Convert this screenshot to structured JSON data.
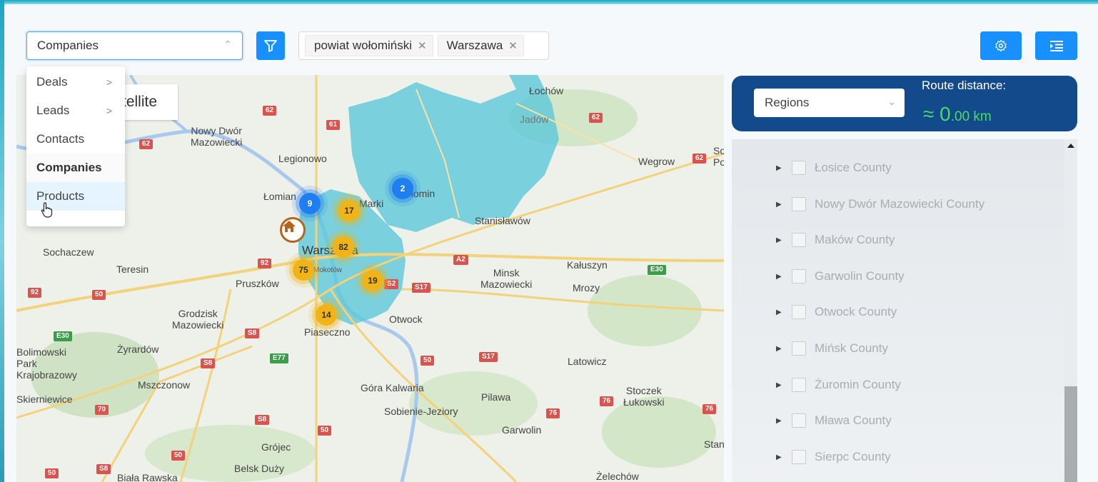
{
  "toolbar": {
    "entity_select_value": "Companies",
    "filter_tags": [
      "powiat wołomiński",
      "Warszawa"
    ]
  },
  "dropdown": {
    "items": [
      {
        "label": "Deals",
        "has_submenu": true
      },
      {
        "label": "Leads",
        "has_submenu": true
      },
      {
        "label": "Contacts",
        "has_submenu": false
      },
      {
        "label": "Companies",
        "has_submenu": false,
        "selected": true
      },
      {
        "label": "Products",
        "has_submenu": false,
        "hovered": true
      }
    ]
  },
  "map": {
    "satellite_label": "tellite",
    "places": [
      "Łochów",
      "Jadów",
      "Nowy Dwór\nMazowiecki",
      "Legionowo",
      "Wegrow",
      "Łomian",
      "Stanisławów",
      "Sochaczew",
      "Teresin",
      "Pruszków",
      "Minsk\nMazowiecki",
      "Kałuszyn",
      "Mrozy",
      "Grodzisk\nMazowiecki",
      "Otwock",
      "Piaseczno",
      "Żyrardów",
      "Bolimowski\nPark\nKrajobrazowy",
      "Mszczonow",
      "Skierniewice",
      "Latowicz",
      "Góra Kalwaria",
      "Pilawa",
      "Stoczek\nŁukowski",
      "Sobienie-Jeziory",
      "Garwolin",
      "Grójec",
      "Belsk Duży",
      "Biała Rawska",
      "Żelechów",
      "Stan",
      "Warszawa",
      "Mokotów",
      "Marki",
      "Wołomin",
      "So\nPo"
    ],
    "clusters": [
      {
        "count": "9",
        "color": "blue"
      },
      {
        "count": "2",
        "color": "blue"
      },
      {
        "count": "17",
        "color": "orange"
      },
      {
        "count": "82",
        "color": "orange"
      },
      {
        "count": "75",
        "color": "orange"
      },
      {
        "count": "19",
        "color": "orange"
      },
      {
        "count": "14",
        "color": "orange"
      }
    ],
    "road_numbers": [
      "62",
      "61",
      "62",
      "62",
      "62",
      "E30",
      "92",
      "50",
      "S8",
      "A2",
      "S17",
      "E30",
      "50",
      "S8",
      "E77",
      "50",
      "S17",
      "S2",
      "S8",
      "50",
      "70",
      "76",
      "76",
      "76",
      "50",
      "S8",
      "92"
    ]
  },
  "route_panel": {
    "regions_select_value": "Regions",
    "route_distance_title": "Route distance:",
    "route_distance_prefix": "≈ 0",
    "route_distance_suffix": ".00 km"
  },
  "regions_list": [
    "Łosice County",
    "Nowy Dwór Mazowiecki County",
    "Maków County",
    "Garwolin County",
    "Otwock County",
    "Mińsk County",
    "Żuromin County",
    "Mława County",
    "Sierpc County"
  ],
  "colors": {
    "primary": "#1890ff",
    "route_panel": "#134a8c",
    "route_distance": "#4cd964",
    "region_fill": "#5cc8d8"
  }
}
